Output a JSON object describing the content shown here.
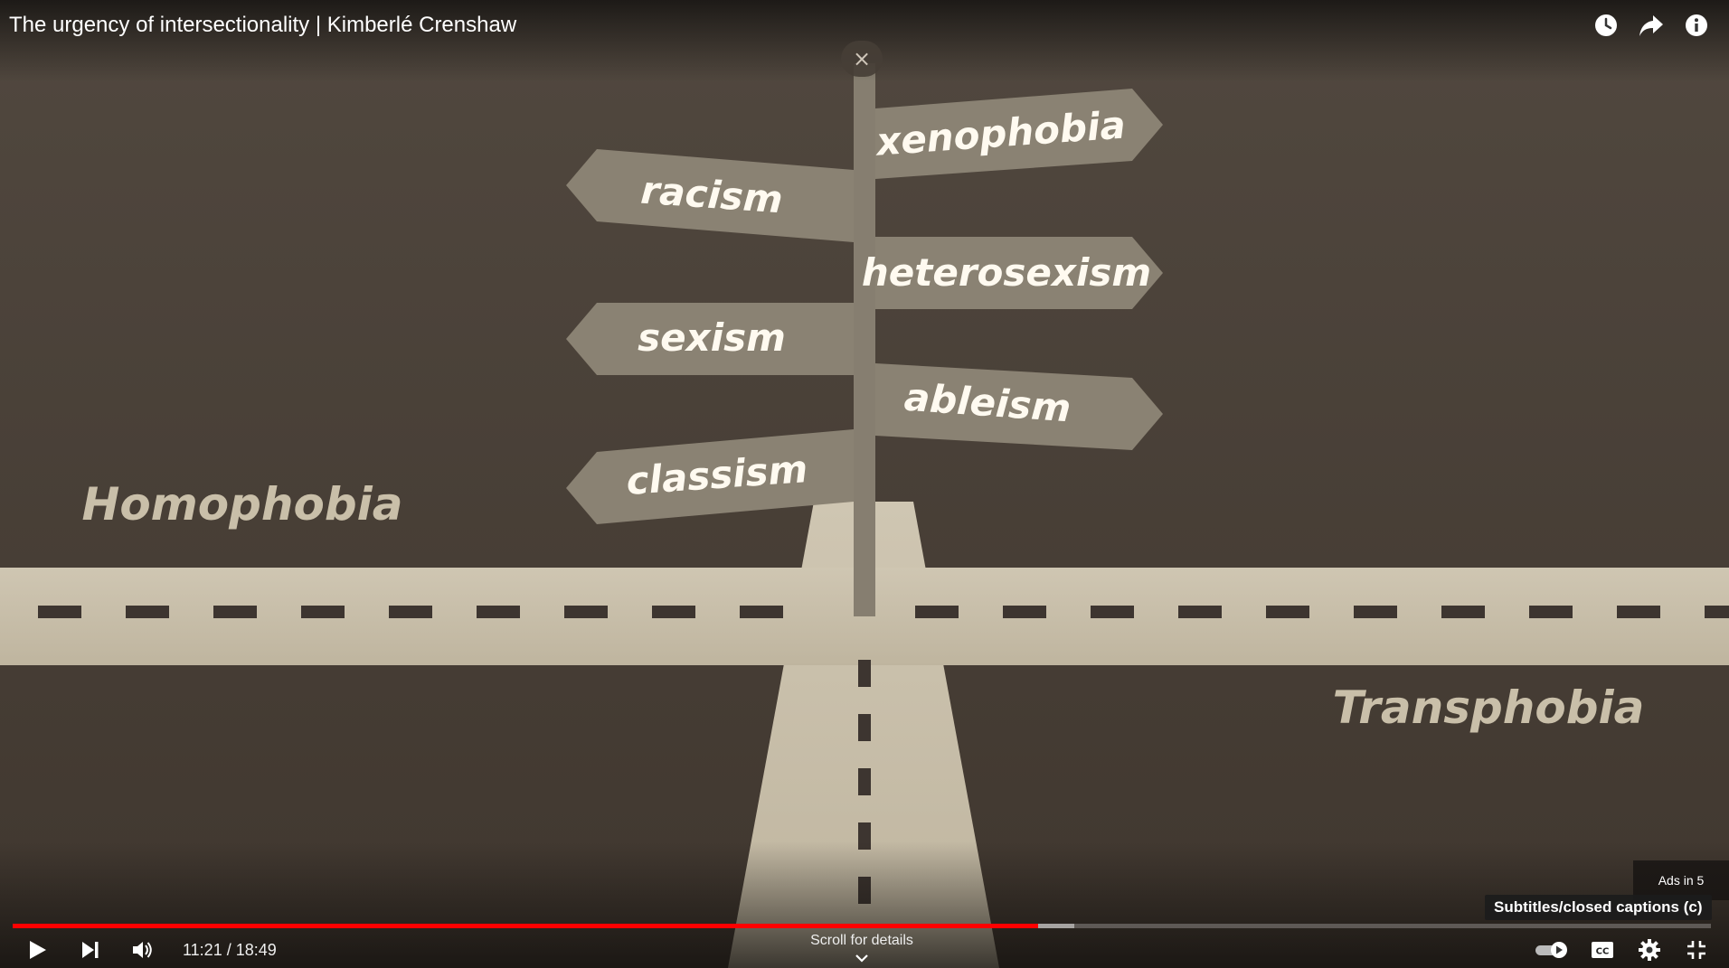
{
  "header": {
    "title": "The urgency of intersectionality | Kimberlé Crenshaw"
  },
  "video_frame": {
    "signs_left": [
      "racism",
      "sexism",
      "classism"
    ],
    "signs_right": [
      "xenophobia",
      "heterosexism",
      "ableism"
    ],
    "road_labels": [
      "Homophobia",
      "Transphobia"
    ]
  },
  "overlay": {
    "close_glyph": "×",
    "scroll_details": "Scroll for details",
    "ads_label": "Ads in 5",
    "tooltip": "Subtitles/closed captions (c)"
  },
  "player": {
    "time_display": "11:21 / 18:49",
    "progress_played_pct": 60.4,
    "progress_buffered_pct": 62.5
  },
  "icons": {
    "top": [
      "watch-later-icon",
      "share-icon",
      "info-icon"
    ],
    "bottom_left": [
      "play-icon",
      "next-icon",
      "volume-icon"
    ],
    "bottom_right": [
      "autoplay-toggle",
      "subtitles-icon",
      "settings-icon",
      "exit-fullscreen-icon"
    ]
  },
  "colors": {
    "background": "#4a4138",
    "road": "#c9bfa9",
    "sign": "#8a8273",
    "progress_played": "#ff0000"
  }
}
